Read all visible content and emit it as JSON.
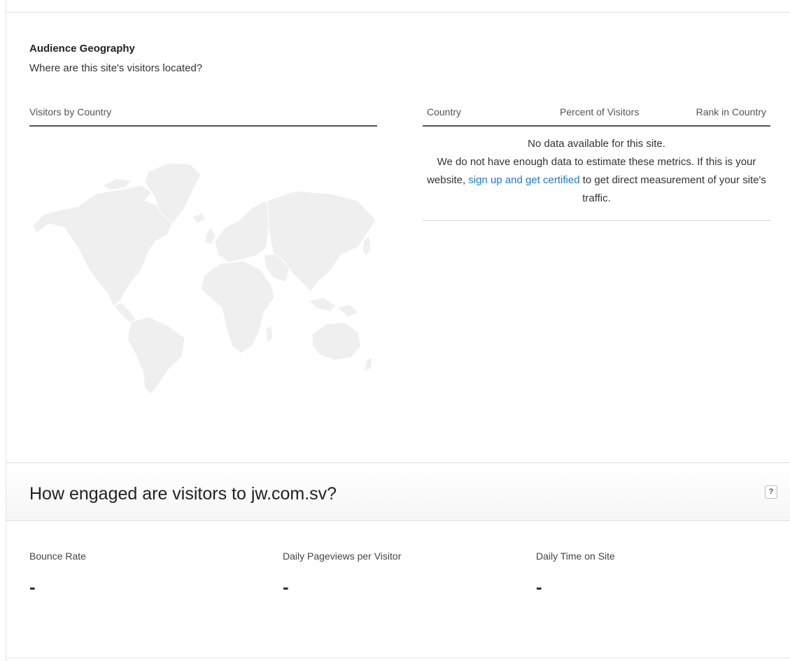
{
  "geography": {
    "title": "Audience Geography",
    "subtitle": "Where are this site's visitors located?",
    "map_header": "Visitors by Country",
    "map_fill_color": "#efefef",
    "table": {
      "columns": [
        "Country",
        "Percent of Visitors",
        "Rank in Country"
      ],
      "empty_line1": "No data available for this site.",
      "empty_line2_prefix": "We do not have enough data to estimate these metrics. If this is your website, ",
      "empty_link": "sign up and get certified",
      "empty_line2_suffix": " to get direct measurement of your site's traffic."
    },
    "link_color": "#1f7ad6"
  },
  "engagement": {
    "title": "How engaged are visitors to jw.com.sv?",
    "help_label": "?",
    "metrics": [
      {
        "label": "Bounce Rate",
        "value": "-"
      },
      {
        "label": "Daily Pageviews per Visitor",
        "value": "-"
      },
      {
        "label": "Daily Time on Site",
        "value": "-"
      }
    ]
  }
}
